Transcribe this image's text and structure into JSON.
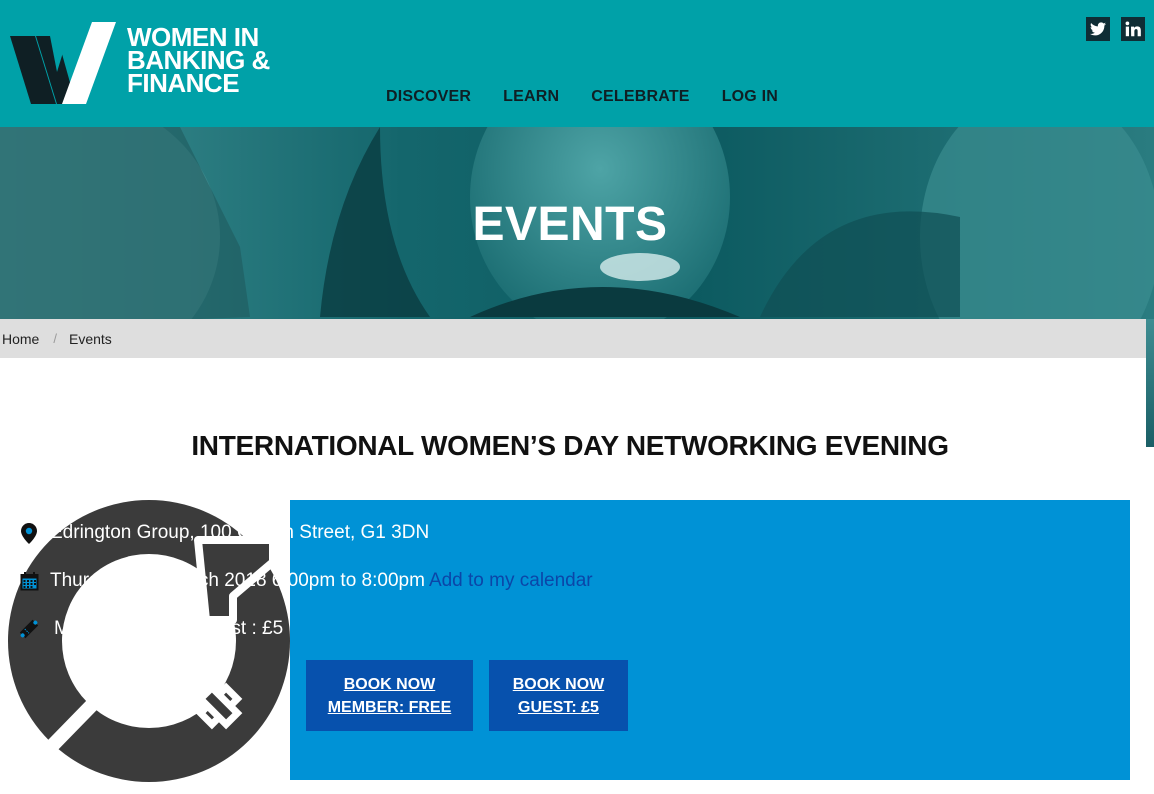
{
  "header": {
    "logo_lines": [
      "WOMEN IN",
      "BANKING &",
      "FINANCE"
    ],
    "nav": [
      "DISCOVER",
      "LEARN",
      "CELEBRATE",
      "LOG IN"
    ],
    "social_icons": [
      "twitter-icon",
      "linkedin-icon"
    ]
  },
  "hero": {
    "title": "EVENTS"
  },
  "breadcrumb": {
    "home": "Home",
    "separator": "/",
    "current": "Events"
  },
  "event": {
    "title": "INTERNATIONAL WOMEN’S DAY NETWORKING EVENING",
    "location": "Edrington Group, 100 Queen Street, G1 3DN",
    "datetime": "Thursday 8th March 2018 6:00pm to 8:00pm",
    "calendar_link": "Add to my calendar",
    "price": "Member : FREE Guest : £5",
    "book_member": {
      "line1": "BOOK NOW",
      "line2": "MEMBER: FREE"
    },
    "book_guest": {
      "line1": "BOOK NOW",
      "line2": "GUEST: £5"
    }
  },
  "colors": {
    "header_teal": "#00a1a8",
    "panel_blue": "#0092d6",
    "button_blue": "#0751ad",
    "link_blue": "#0b46a8",
    "breadcrumb_grey": "#dedede",
    "logo_dark": "#0f1f24"
  }
}
